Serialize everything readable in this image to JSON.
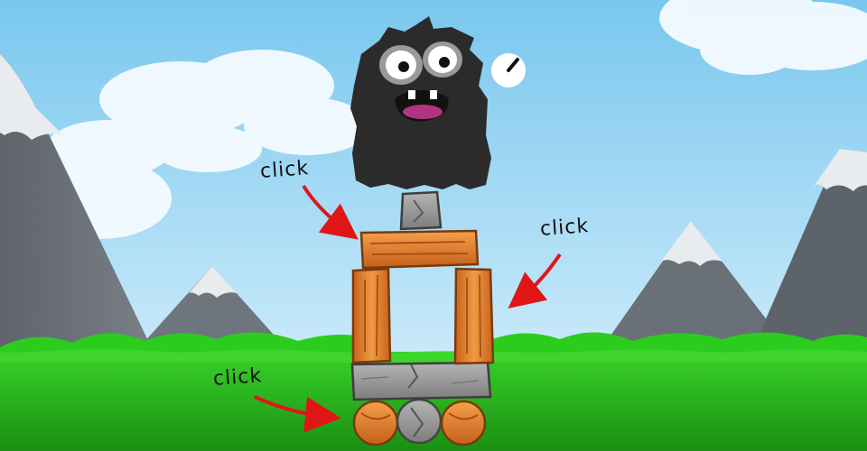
{
  "game": {
    "hints": [
      {
        "label": "click",
        "target": "top-wooden-plank"
      },
      {
        "label": "click",
        "target": "right-wooden-pillar"
      },
      {
        "label": "click",
        "target": "left-wooden-ball"
      }
    ],
    "timer_icon": "stopwatch-icon",
    "colors": {
      "sky": "#bfe6fb",
      "grass": "#27c21b",
      "wood": "#e07b2a",
      "stone": "#9a9a9a",
      "monster": "#2b2b2b",
      "arrow": "#e01616"
    }
  }
}
